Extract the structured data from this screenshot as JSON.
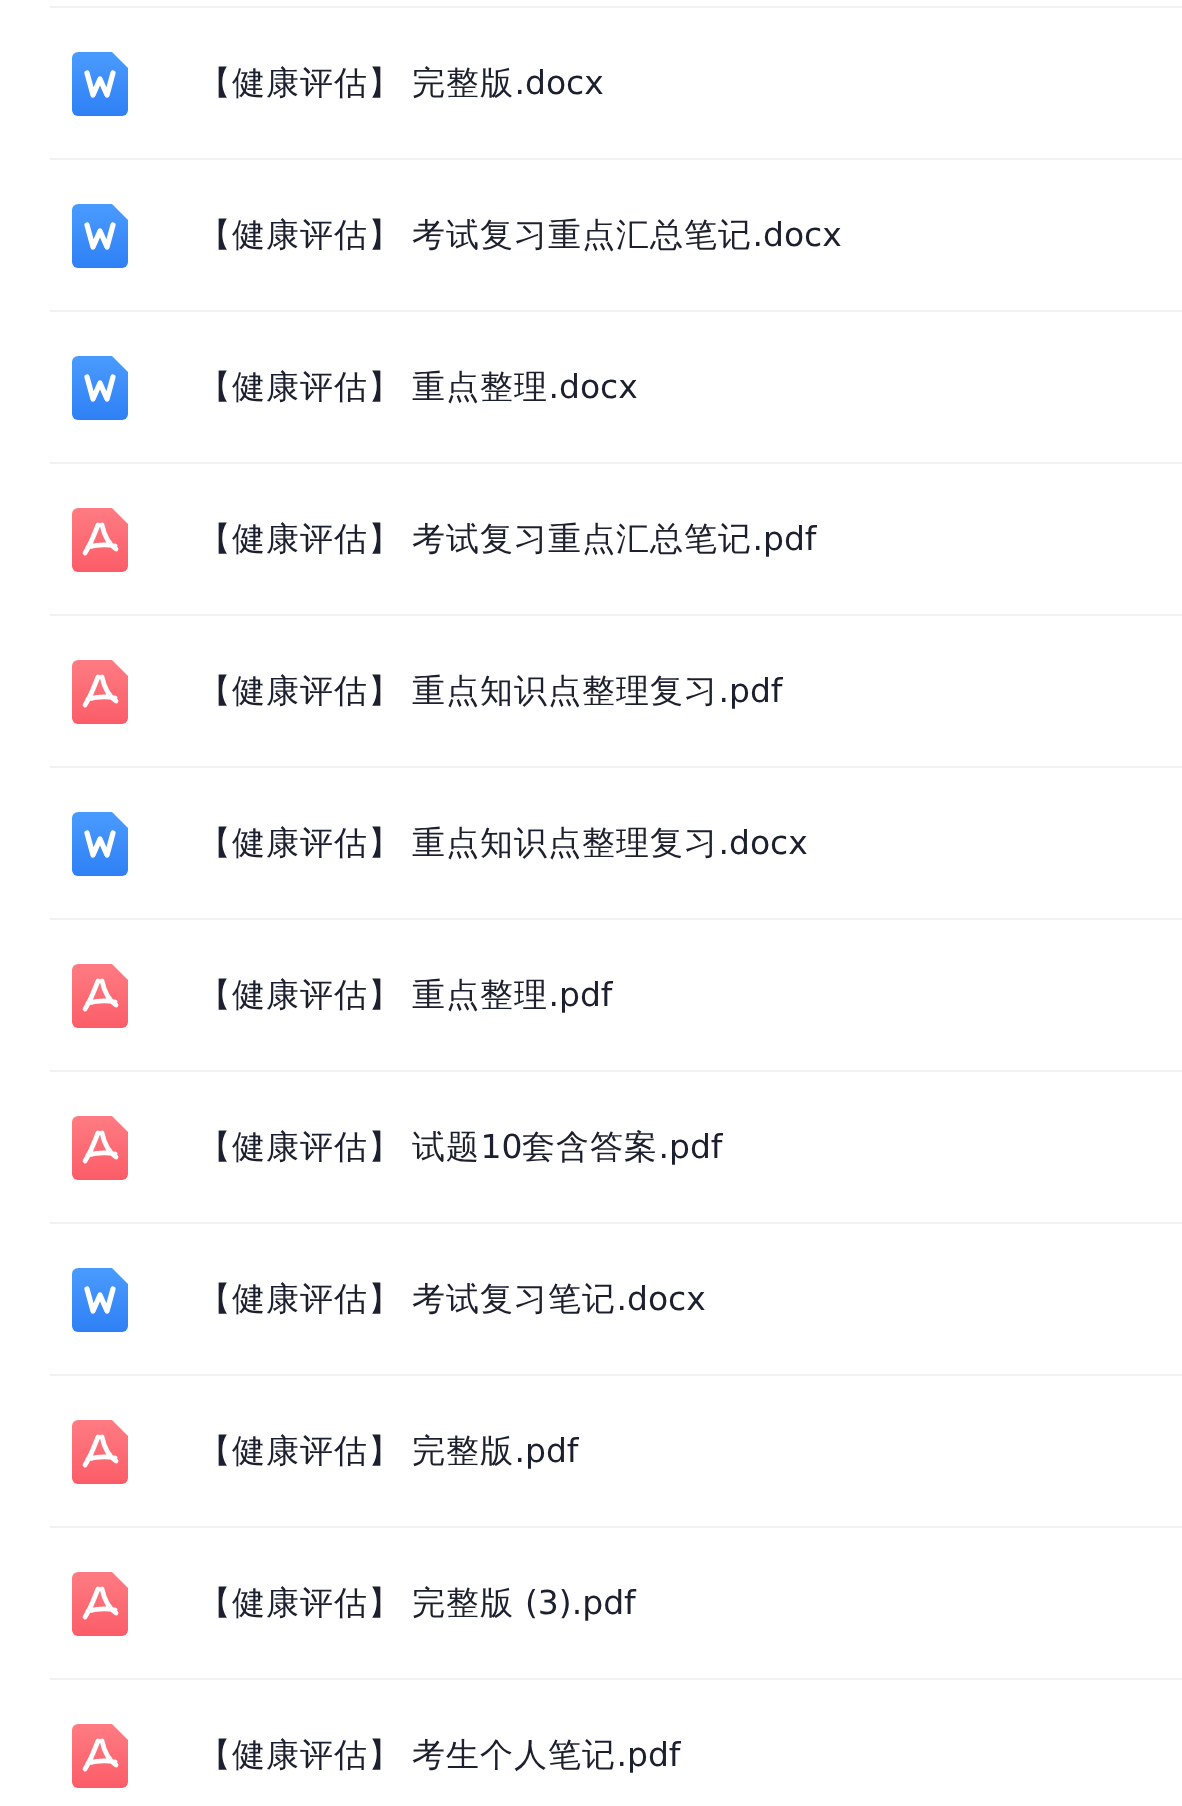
{
  "files": [
    {
      "kind": "docx",
      "name": "【健康评估】 完整版.docx"
    },
    {
      "kind": "docx",
      "name": "【健康评估】 考试复习重点汇总笔记.docx"
    },
    {
      "kind": "docx",
      "name": "【健康评估】 重点整理.docx"
    },
    {
      "kind": "pdf",
      "name": "【健康评估】 考试复习重点汇总笔记.pdf"
    },
    {
      "kind": "pdf",
      "name": "【健康评估】 重点知识点整理复习.pdf"
    },
    {
      "kind": "docx",
      "name": "【健康评估】 重点知识点整理复习.docx"
    },
    {
      "kind": "pdf",
      "name": "【健康评估】 重点整理.pdf"
    },
    {
      "kind": "pdf",
      "name": "【健康评估】 试题10套含答案.pdf"
    },
    {
      "kind": "docx",
      "name": "【健康评估】 考试复习笔记.docx"
    },
    {
      "kind": "pdf",
      "name": "【健康评估】 完整版.pdf"
    },
    {
      "kind": "pdf",
      "name": "【健康评估】 完整版 (3).pdf"
    },
    {
      "kind": "pdf",
      "name": "【健康评估】 考生个人笔记.pdf"
    }
  ]
}
